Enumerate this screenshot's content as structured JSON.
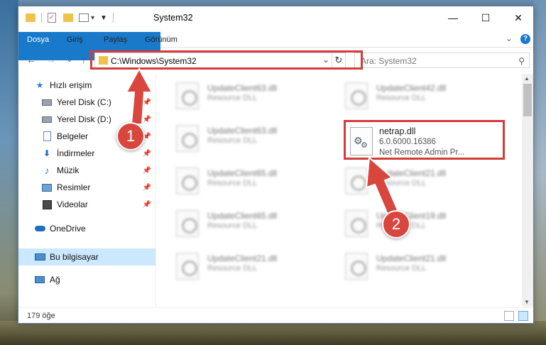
{
  "window": {
    "title": "System32",
    "controls": {
      "minimize": "—",
      "maximize": "☐",
      "close": "✕"
    }
  },
  "ribbon": {
    "tabs": [
      "Dosya",
      "Giriş",
      "Paylaş",
      "Görünüm"
    ],
    "collapse": "⌄",
    "help": "?"
  },
  "address_bar": {
    "path": "C:\\Windows\\System32",
    "dropdown": "⌄",
    "refresh": "↻"
  },
  "search": {
    "placeholder": "Ara: System32",
    "icon": "search-icon"
  },
  "nav": {
    "back": "←",
    "forward": "→",
    "recent": "⌄",
    "up": "↑"
  },
  "sidebar": {
    "items": [
      {
        "label": "Hızlı erişim",
        "icon": "star-icon",
        "pinned": false
      },
      {
        "label": "Yerel Disk (C:)",
        "icon": "drive-icon",
        "pinned": true
      },
      {
        "label": "Yerel Disk (D:)",
        "icon": "drive-icon",
        "pinned": true
      },
      {
        "label": "Belgeler",
        "icon": "document-icon",
        "pinned": true
      },
      {
        "label": "İndirmeler",
        "icon": "download-icon",
        "pinned": true
      },
      {
        "label": "Müzik",
        "icon": "music-icon",
        "pinned": true
      },
      {
        "label": "Resimler",
        "icon": "pictures-icon",
        "pinned": true
      },
      {
        "label": "Videolar",
        "icon": "video-icon",
        "pinned": true
      },
      {
        "label": "OneDrive",
        "icon": "cloud-icon",
        "pinned": false
      },
      {
        "label": "Bu bilgisayar",
        "icon": "computer-icon",
        "pinned": false
      },
      {
        "label": "Ağ",
        "icon": "network-icon",
        "pinned": false
      }
    ]
  },
  "files": [
    {
      "name": "UpdateClient63.dll",
      "type": "Resource DLL"
    },
    {
      "name": "UpdateClient42.dll",
      "type": "Resource DLL"
    },
    {
      "name": "UpdateClient63.dll",
      "type": "Resource DLL"
    },
    {
      "name": "UpdateClient65.dll",
      "type": "Resource DLL"
    },
    {
      "name": "UpdateClient21.dll",
      "type": "Resource DLL"
    },
    {
      "name": "UpdateClient65.dll",
      "type": "Resource DLL"
    },
    {
      "name": "UpdateClient19.dll",
      "type": "Resource DLL"
    },
    {
      "name": "UpdateClient21.dll",
      "type": "Resource DLL"
    },
    {
      "name": "UpdateClient21.dll",
      "type": "Resource DLL"
    }
  ],
  "highlighted_file": {
    "name": "netrap.dll",
    "version": "6.0.6000.16386",
    "description": "Net Remote Admin Pr..."
  },
  "status": {
    "item_count": "179 öğe"
  },
  "annotations": {
    "step1": "1",
    "step2": "2",
    "color": "#d8463e"
  }
}
